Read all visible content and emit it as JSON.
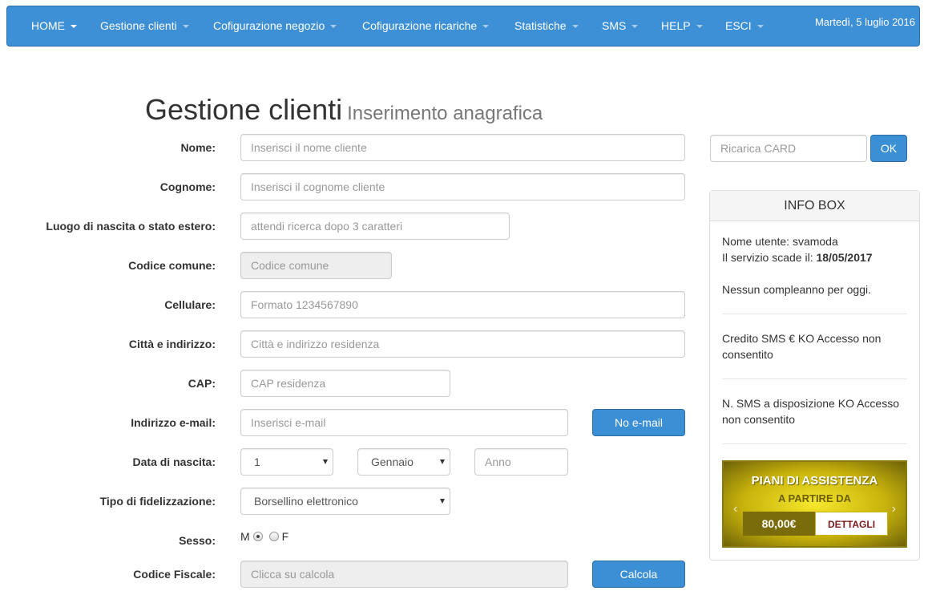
{
  "nav": {
    "items": [
      {
        "label": "HOME"
      },
      {
        "label": "Gestione clienti"
      },
      {
        "label": "Cofigurazione negozio"
      },
      {
        "label": "Cofigurazione ricariche"
      },
      {
        "label": "Statistiche"
      },
      {
        "label": "SMS"
      },
      {
        "label": "HELP"
      },
      {
        "label": "ESCI"
      }
    ],
    "date": "Martedì, 5 luglio 2016"
  },
  "header": {
    "title": "Gestione clienti",
    "subtitle": "Inserimento anagrafica"
  },
  "form": {
    "nome": {
      "label": "Nome:",
      "placeholder": "Inserisci il nome cliente"
    },
    "cognome": {
      "label": "Cognome:",
      "placeholder": "Inserisci il cognome cliente"
    },
    "luogo": {
      "label": "Luogo di nascita o stato estero:",
      "placeholder": "attendi ricerca dopo 3 caratteri"
    },
    "codice_comune": {
      "label": "Codice comune:",
      "placeholder": "Codice comune"
    },
    "cellulare": {
      "label": "Cellulare:",
      "placeholder": "Formato 1234567890"
    },
    "citta": {
      "label": "Città e indirizzo:",
      "placeholder": "Città e indirizzo residenza"
    },
    "cap": {
      "label": "CAP:",
      "placeholder": "CAP residenza"
    },
    "email": {
      "label": "Indirizzo e-mail:",
      "placeholder": "Inserisci e-mail",
      "button": "No e-mail"
    },
    "nascita": {
      "label": "Data di nascita:",
      "day": "1",
      "month": "Gennaio",
      "year_placeholder": "Anno"
    },
    "fidelizzazione": {
      "label": "Tipo di fidelizzazione:",
      "value": "Borsellino elettronico"
    },
    "sesso": {
      "label": "Sesso:",
      "m": "M",
      "f": "F",
      "selected": "M"
    },
    "codice_fiscale": {
      "label": "Codice Fiscale:",
      "placeholder": "Clicca su calcola",
      "button": "Calcola"
    }
  },
  "card": {
    "placeholder": "Ricarica CARD",
    "button": "OK"
  },
  "infobox": {
    "title": "INFO BOX",
    "user_line": "Nome utente: svamoda",
    "expiry_prefix": "Il servizio scade il: ",
    "expiry_date": "18/05/2017",
    "birthdays": "Nessun compleanno per oggi.",
    "credit_line1": "Credito SMS € KO Accesso non",
    "credit_line2": "consentito",
    "sms_line1": "N. SMS a disposizione KO Accesso",
    "sms_line2": "non consentito",
    "banner": {
      "line1": "PIANI DI ASSISTENZA",
      "line2": "A PARTIRE DA",
      "price": "80,00€",
      "button": "DETTAGLI"
    }
  },
  "colors": {
    "navbar": "#3d8fd6",
    "primary_button": "#3b8fd5",
    "banner_gold": "#e0cd1a"
  }
}
